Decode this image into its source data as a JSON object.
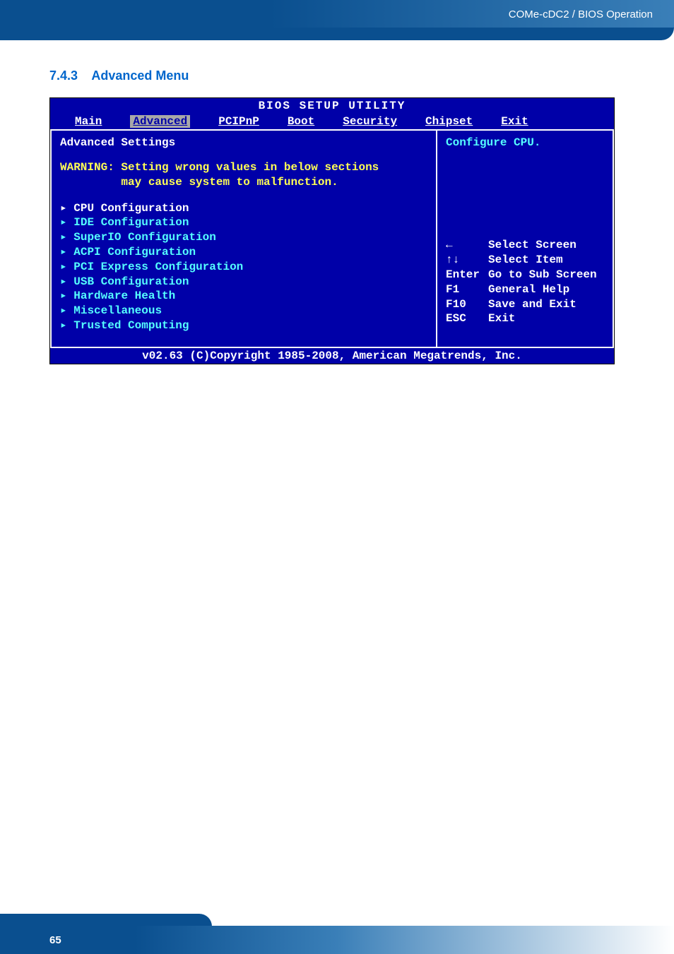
{
  "header": {
    "breadcrumb": "COMe-cDC2 / BIOS Operation"
  },
  "section": {
    "number": "7.4.3",
    "title": "Advanced Menu"
  },
  "bios": {
    "title": "BIOS SETUP UTILITY",
    "tabs": {
      "main": "Main",
      "advanced": "Advanced",
      "pcipnp": "PCIPnP",
      "boot": "Boot",
      "security": "Security",
      "chipset": "Chipset",
      "exit": "Exit"
    },
    "left_panel": {
      "title": "Advanced Settings",
      "warning_label": "WARNING:",
      "warning_line1": "Setting wrong values in below sections",
      "warning_line2": "may cause system to malfunction.",
      "items": [
        "CPU Configuration",
        "IDE Configuration",
        "SuperIO Configuration",
        "ACPI Configuration",
        "PCI Express Configuration",
        "USB Configuration",
        "Hardware Health",
        "Miscellaneous",
        "Trusted Computing"
      ]
    },
    "right_panel": {
      "help": "Configure CPU.",
      "nav": [
        {
          "key": "←",
          "label": "Select Screen"
        },
        {
          "key": "↑↓",
          "label": "Select Item"
        },
        {
          "key": "Enter",
          "label": "Go to Sub Screen"
        },
        {
          "key": "F1",
          "label": "General Help"
        },
        {
          "key": "F10",
          "label": "Save and Exit"
        },
        {
          "key": "ESC",
          "label": "Exit"
        }
      ]
    },
    "footer": "v02.63 (C)Copyright 1985-2008, American Megatrends, Inc."
  },
  "page": {
    "number": "65"
  }
}
